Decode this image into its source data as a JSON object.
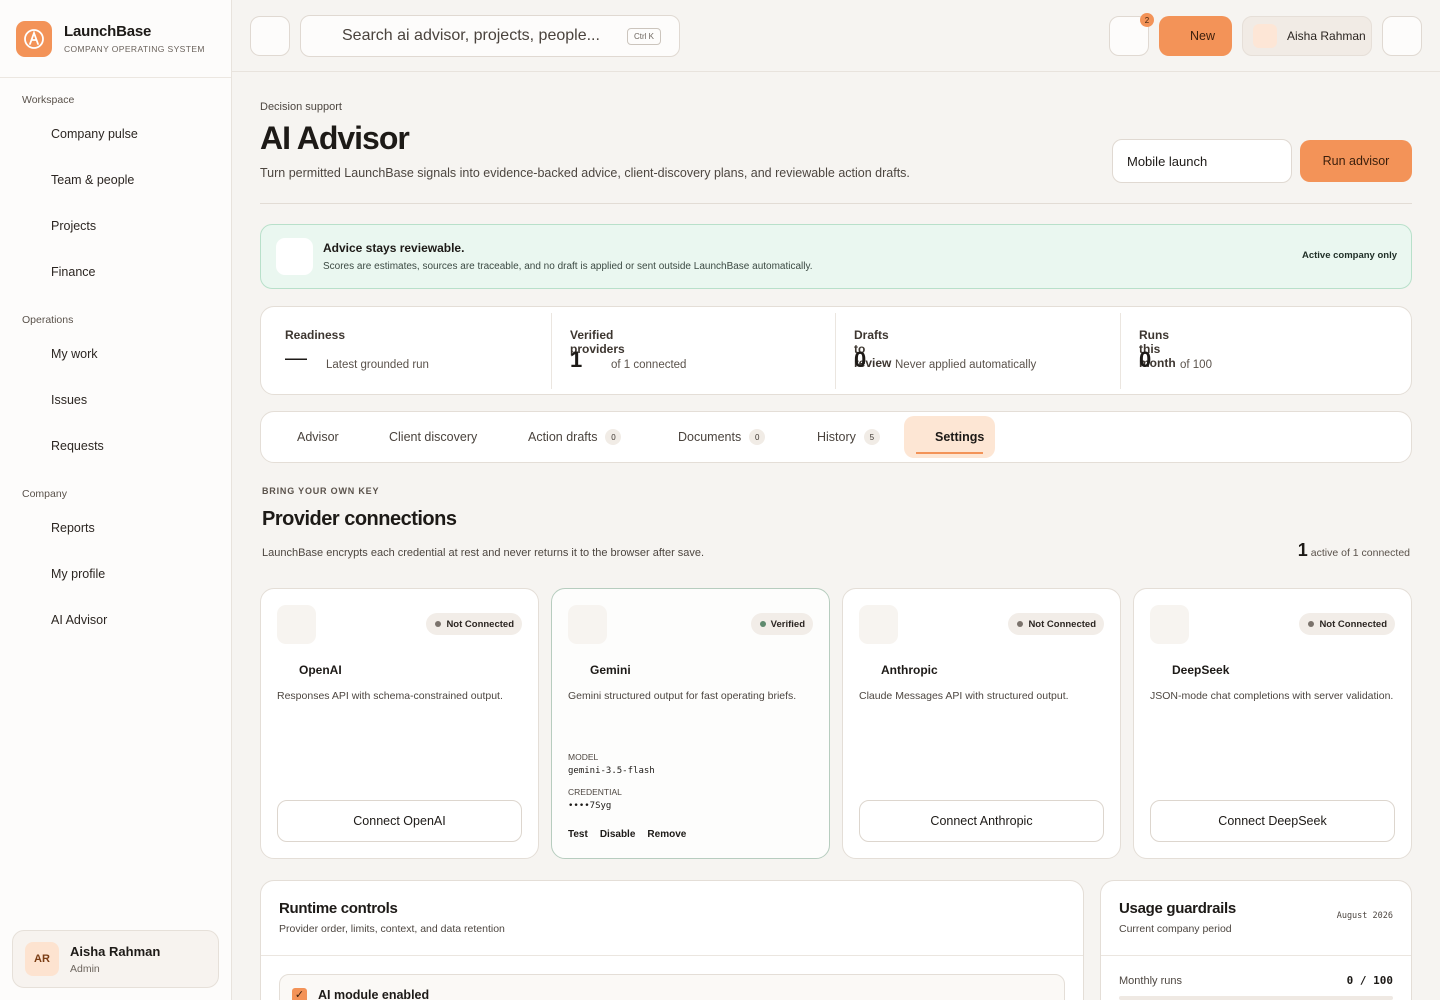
{
  "brand": {
    "name": "LaunchBase",
    "subtitle": "COMPANY OPERATING SYSTEM"
  },
  "sidebar": {
    "groups": [
      {
        "label": "Workspace",
        "items": [
          "Company pulse",
          "Team & people",
          "Projects",
          "Finance"
        ]
      },
      {
        "label": "Operations",
        "items": [
          "My work",
          "Issues",
          "Requests"
        ]
      },
      {
        "label": "Company",
        "items": [
          "Reports",
          "My profile",
          "AI Advisor"
        ]
      }
    ],
    "user": {
      "initials": "AR",
      "name": "Aisha Rahman",
      "role": "Admin"
    }
  },
  "topbar": {
    "search_placeholder": "Search ai advisor, projects, people...",
    "search_shortcut": "Ctrl K",
    "notification_count": "2",
    "new_label": "New",
    "user_name": "Aisha Rahman"
  },
  "header": {
    "eyebrow": "Decision support",
    "title": "AI Advisor",
    "description": "Turn permitted LaunchBase signals into evidence-backed advice, client-discovery plans, and reviewable action drafts.",
    "project_value": "Mobile launch",
    "run_label": "Run advisor"
  },
  "notice": {
    "title": "Advice stays reviewable.",
    "text": "Scores are estimates, sources are traceable, and no draft is applied or sent outside LaunchBase automatically.",
    "scope": "Active company only"
  },
  "stats": [
    {
      "label": "Readiness",
      "value": "—",
      "sub": "Latest grounded run"
    },
    {
      "label": "Verified providers",
      "value": "1",
      "sub": "of 1 connected"
    },
    {
      "label": "Drafts to review",
      "value": "0",
      "sub": "Never applied automatically"
    },
    {
      "label": "Runs this month",
      "value": "0",
      "sub": "of 100"
    }
  ],
  "tabs": [
    {
      "label": "Advisor",
      "count": ""
    },
    {
      "label": "Client discovery",
      "count": ""
    },
    {
      "label": "Action drafts",
      "count": "0"
    },
    {
      "label": "Documents",
      "count": "0"
    },
    {
      "label": "History",
      "count": "5"
    },
    {
      "label": "Settings",
      "count": "",
      "active": true
    }
  ],
  "providers_section": {
    "eyebrow": "BRING YOUR OWN KEY",
    "title": "Provider connections",
    "description": "LaunchBase encrypts each credential at rest and never returns it to the browser after save.",
    "active_count": "1",
    "active_text": "active of 1 connected"
  },
  "providers": [
    {
      "name": "OpenAI",
      "status": "Not Connected",
      "description": "Responses API with schema-constrained output.",
      "button": "Connect OpenAI"
    },
    {
      "name": "Gemini",
      "status": "Verified",
      "description": "Gemini structured output for fast operating briefs.",
      "model_label": "MODEL",
      "model": "gemini-3.5-flash",
      "credential_label": "CREDENTIAL",
      "credential": "••••7Syg",
      "actions": [
        "Test",
        "Disable",
        "Remove"
      ]
    },
    {
      "name": "Anthropic",
      "status": "Not Connected",
      "description": "Claude Messages API with structured output.",
      "button": "Connect Anthropic"
    },
    {
      "name": "DeepSeek",
      "status": "Not Connected",
      "description": "JSON-mode chat completions with server validation.",
      "button": "Connect DeepSeek"
    }
  ],
  "runtime": {
    "title": "Runtime controls",
    "subtitle": "Provider order, limits, context, and data retention",
    "module_label": "AI module enabled",
    "module_enabled": true
  },
  "usage": {
    "title": "Usage guardrails",
    "subtitle": "Current company period",
    "period": "August 2026",
    "monthly_label": "Monthly runs",
    "monthly_value": "0 / 100",
    "monthly_fraction": 0
  },
  "colors": {
    "accent": "#f39358",
    "notice_bg": "#eaf7f0",
    "verified_dot": "#5f8a6e"
  }
}
